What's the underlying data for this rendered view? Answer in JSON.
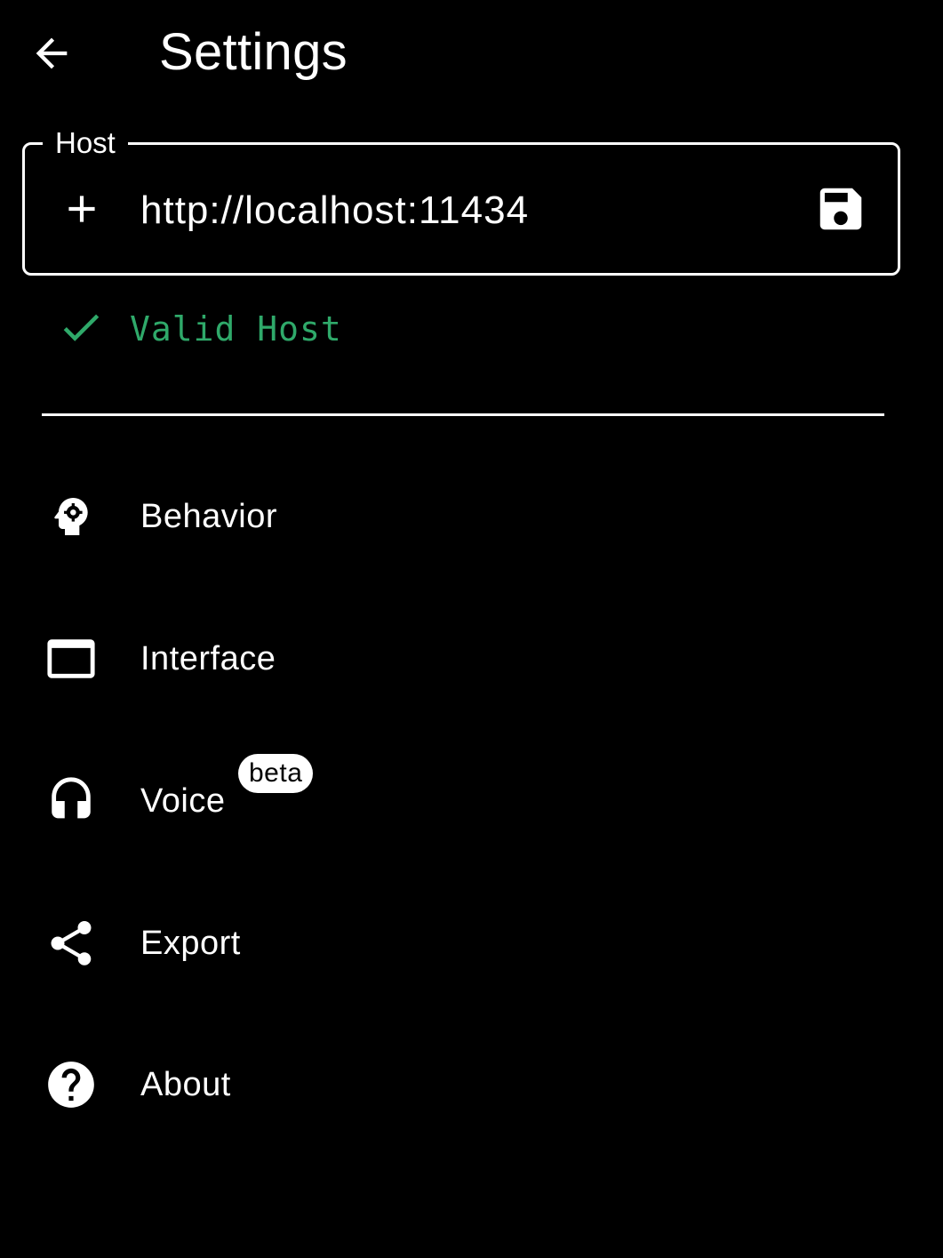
{
  "header": {
    "title": "Settings",
    "back_icon": "arrow-back-icon"
  },
  "host": {
    "label": "Host",
    "value": "http://localhost:11434",
    "add_icon": "plus-icon",
    "save_icon": "save-icon",
    "status_icon": "check-icon",
    "status_text": "Valid Host",
    "status_color": "#2fa96a"
  },
  "menu": {
    "items": [
      {
        "label": "Behavior",
        "icon": "brain-gear-icon"
      },
      {
        "label": "Interface",
        "icon": "window-icon"
      },
      {
        "label": "Voice",
        "icon": "headphones-icon",
        "badge": "beta"
      },
      {
        "label": "Export",
        "icon": "share-icon"
      },
      {
        "label": "About",
        "icon": "help-icon"
      }
    ]
  }
}
